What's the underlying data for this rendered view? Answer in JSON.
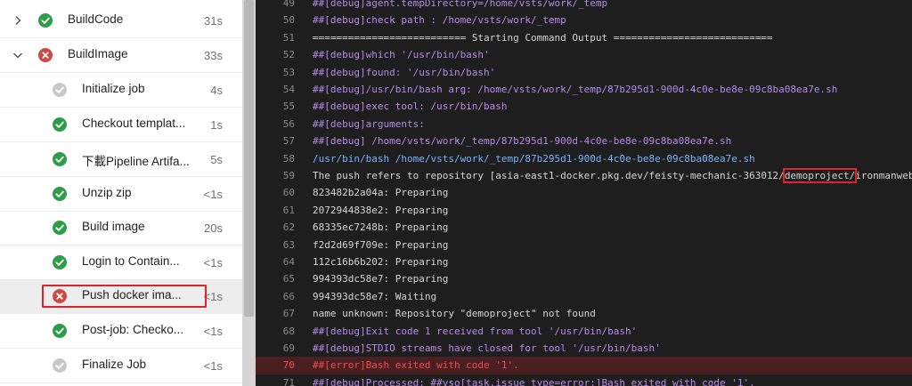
{
  "jobs": [
    {
      "label": "BuildCode",
      "duration": "31s",
      "status": "success",
      "level": 0,
      "chevron": "right"
    },
    {
      "label": "BuildImage",
      "duration": "33s",
      "status": "failed",
      "level": 0,
      "chevron": "down"
    },
    {
      "label": "Initialize job",
      "duration": "4s",
      "status": "skipped",
      "level": 1
    },
    {
      "label": "Checkout templat...",
      "duration": "1s",
      "status": "success",
      "level": 1
    },
    {
      "label": "下載Pipeline Artifa...",
      "duration": "5s",
      "status": "success",
      "level": 1
    },
    {
      "label": "Unzip zip",
      "duration": "<1s",
      "status": "success",
      "level": 1
    },
    {
      "label": "Build image",
      "duration": "20s",
      "status": "success",
      "level": 1
    },
    {
      "label": "Login to Contain...",
      "duration": "<1s",
      "status": "success",
      "level": 1
    },
    {
      "label": "Push docker ima...",
      "duration": "<1s",
      "status": "failed",
      "level": 1,
      "selected": true
    },
    {
      "label": "Post-job: Checko...",
      "duration": "<1s",
      "status": "success",
      "level": 1
    },
    {
      "label": "Finalize Job",
      "duration": "<1s",
      "status": "skipped",
      "level": 1
    }
  ],
  "log": {
    "line59": {
      "num": "59",
      "prefix": "The push refers to repository [asia-east1-docker.pkg.dev/feisty-mechanic-363012/",
      "boxed": "demoproject/",
      "suffix": "ironmanweb]"
    },
    "lines": [
      {
        "num": "49",
        "text": "##[debug]agent.tempDirectory=/home/vsts/work/_temp",
        "kind": "debug"
      },
      {
        "num": "50",
        "text": "##[debug]check path : /home/vsts/work/_temp",
        "kind": "debug"
      },
      {
        "num": "51",
        "text": "========================== Starting Command Output ===========================",
        "kind": "plain"
      },
      {
        "num": "52",
        "text": "##[debug]which '/usr/bin/bash'",
        "kind": "debug"
      },
      {
        "num": "53",
        "text": "##[debug]found: '/usr/bin/bash'",
        "kind": "debug"
      },
      {
        "num": "54",
        "text": "##[debug]/usr/bin/bash arg: /home/vsts/work/_temp/87b295d1-900d-4c0e-be8e-09c8ba08ea7e.sh",
        "kind": "debug"
      },
      {
        "num": "55",
        "text": "##[debug]exec tool: /usr/bin/bash",
        "kind": "debug"
      },
      {
        "num": "56",
        "text": "##[debug]arguments:",
        "kind": "debug"
      },
      {
        "num": "57",
        "text": "##[debug]   /home/vsts/work/_temp/87b295d1-900d-4c0e-be8e-09c8ba08ea7e.sh",
        "kind": "debug"
      },
      {
        "num": "58",
        "text": "/usr/bin/bash /home/vsts/work/_temp/87b295d1-900d-4c0e-be8e-09c8ba08ea7e.sh",
        "kind": "cmd"
      },
      {
        "num": "60",
        "text": "823482b2a04a: Preparing",
        "kind": "plain"
      },
      {
        "num": "61",
        "text": "2072944838e2: Preparing",
        "kind": "plain"
      },
      {
        "num": "62",
        "text": "68335ec7248b: Preparing",
        "kind": "plain"
      },
      {
        "num": "63",
        "text": "f2d2d69f709e: Preparing",
        "kind": "plain"
      },
      {
        "num": "64",
        "text": "112c16b6b202: Preparing",
        "kind": "plain"
      },
      {
        "num": "65",
        "text": "994393dc58e7: Preparing",
        "kind": "plain"
      },
      {
        "num": "66",
        "text": "994393dc58e7: Waiting",
        "kind": "plain"
      },
      {
        "num": "67",
        "text": "name unknown: Repository \"demoproject\" not found",
        "kind": "plain"
      },
      {
        "num": "68",
        "text": "##[debug]Exit code 1 received from tool '/usr/bin/bash'",
        "kind": "debug"
      },
      {
        "num": "69",
        "text": "##[debug]STDIO streams have closed for tool '/usr/bin/bash'",
        "kind": "debug"
      },
      {
        "num": "70",
        "text": "##[error]Bash exited with code '1'.",
        "kind": "error"
      },
      {
        "num": "71",
        "text": "##[debug]Processed: ##vso[task.issue type=error;]Bash exited with code '1'.",
        "kind": "debug"
      }
    ]
  },
  "colors": {
    "success": "#2e9d4a",
    "failed": "#cd4a45",
    "skipped": "#c8c8c8",
    "highlight": "#e0222a"
  }
}
